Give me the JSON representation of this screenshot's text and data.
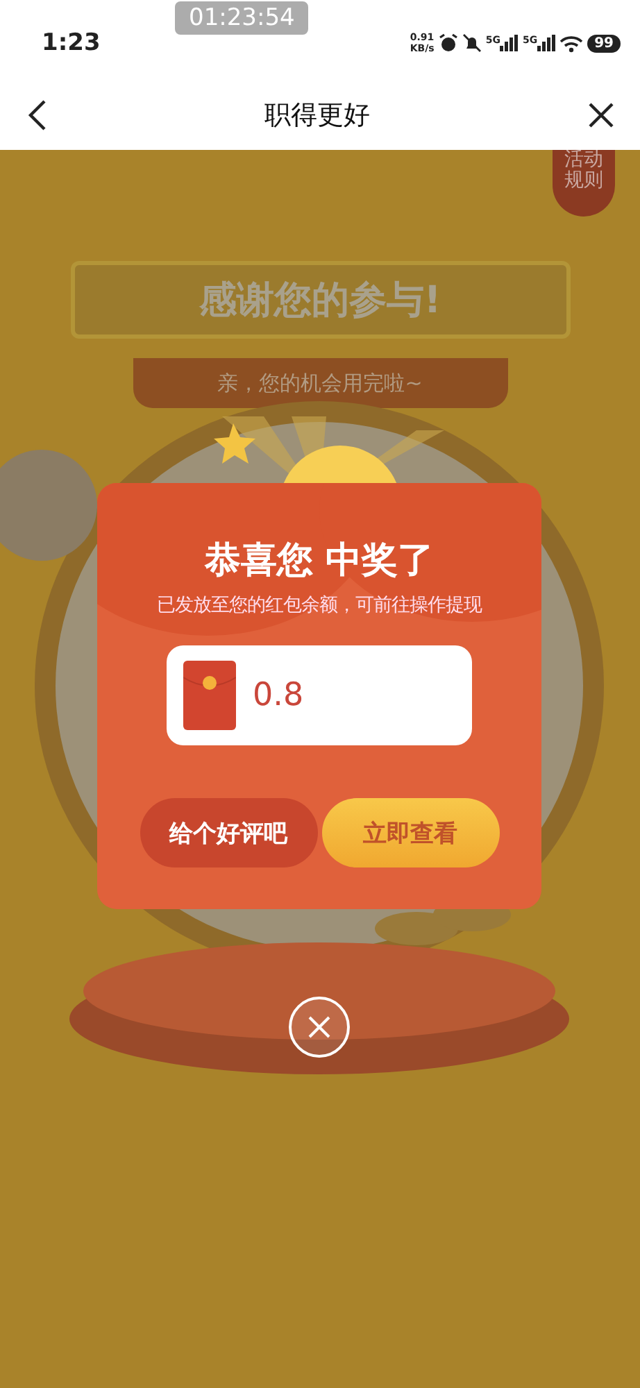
{
  "status_bar": {
    "time": "1:23",
    "timer": "01:23:54",
    "net_speed_value": "0.91",
    "net_speed_unit": "KB/s",
    "signals": [
      {
        "label": "5G"
      },
      {
        "label": "5G"
      }
    ],
    "battery": "99"
  },
  "nav": {
    "title": "职得更好"
  },
  "background": {
    "rules_badge": "活动规则",
    "banner": "感谢您的参与!",
    "subtitle": "亲，您的机会用完啦~"
  },
  "dialog": {
    "title": "恭喜您 中奖了",
    "message": "已发放至您的红包余额，可前往操作提现",
    "amount": "0.8",
    "buttons": [
      {
        "label": "给个好评吧",
        "kind": "secondary"
      },
      {
        "label": "立即查看",
        "kind": "primary"
      }
    ]
  }
}
